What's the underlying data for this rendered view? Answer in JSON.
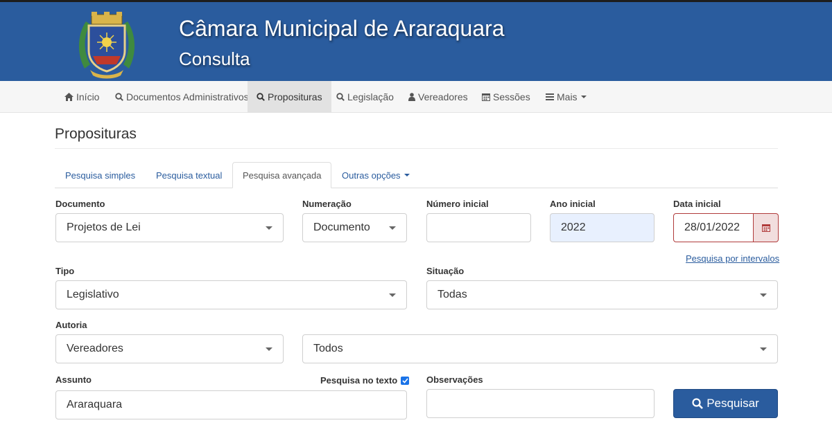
{
  "header": {
    "title": "Câmara Municipal de Araraquara",
    "subtitle": "Consulta",
    "logo_icon": "coat-of-arms-icon"
  },
  "navbar": {
    "items": [
      {
        "label": "Início",
        "icon": "home-icon"
      },
      {
        "label": "Documentos Administrativos",
        "icon": "search-icon"
      },
      {
        "label": "Proposituras",
        "icon": "search-icon",
        "active": true
      },
      {
        "label": "Legislação",
        "icon": "search-icon"
      },
      {
        "label": "Vereadores",
        "icon": "user-icon"
      },
      {
        "label": "Sessões",
        "icon": "calendar-icon"
      },
      {
        "label": "Mais",
        "icon": "menu-icon"
      }
    ]
  },
  "page": {
    "title": "Proposituras"
  },
  "tabs": [
    {
      "label": "Pesquisa simples"
    },
    {
      "label": "Pesquisa textual"
    },
    {
      "label": "Pesquisa avançada",
      "active": true
    },
    {
      "label": "Outras opções"
    }
  ],
  "form": {
    "documento": {
      "label": "Documento",
      "value": "Projetos de Lei"
    },
    "numeracao": {
      "label": "Numeração",
      "value": "Documento"
    },
    "numero_inicial": {
      "label": "Número inicial",
      "value": ""
    },
    "ano_inicial": {
      "label": "Ano inicial",
      "value": "2022"
    },
    "data_inicial": {
      "label": "Data inicial",
      "value": "28/01/2022"
    },
    "intervalos_link": "Pesquisa por intervalos",
    "tipo": {
      "label": "Tipo",
      "value": "Legislativo"
    },
    "situacao": {
      "label": "Situação",
      "value": "Todas"
    },
    "autoria": {
      "label": "Autoria",
      "value": "Vereadores",
      "value2": "Todos"
    },
    "assunto": {
      "label": "Assunto",
      "value": "Araraquara"
    },
    "pesquisa_no_texto": {
      "label": "Pesquisa no texto",
      "checked": true
    },
    "observacoes": {
      "label": "Observações",
      "value": ""
    },
    "submit_label": "Pesquisar"
  },
  "colors": {
    "brand": "#2a5c9e",
    "date_error": "#b03a3a",
    "autofill": "#e8f0fe"
  }
}
